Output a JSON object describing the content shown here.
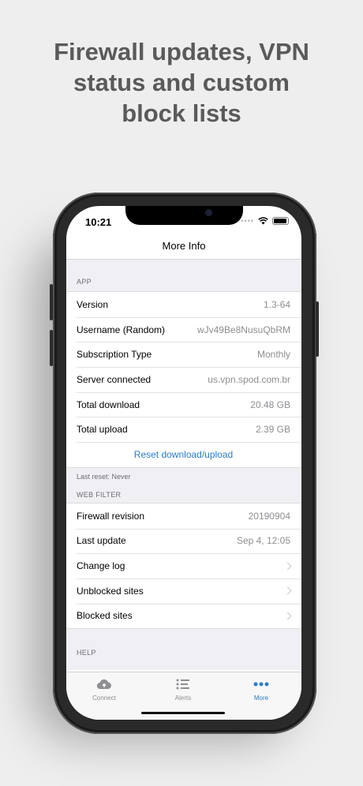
{
  "promo": {
    "line1": "Firewall updates, VPN",
    "line2": "status and custom",
    "line3": "block lists"
  },
  "status_bar": {
    "time": "10:21"
  },
  "nav": {
    "title": "More Info"
  },
  "sections": {
    "app": {
      "header": "APP",
      "rows": [
        {
          "label": "Version",
          "value": "1.3-64"
        },
        {
          "label": "Username (Random)",
          "value": "wJv49Be8NusuQbRM"
        },
        {
          "label": "Subscription Type",
          "value": "Monthly"
        },
        {
          "label": "Server connected",
          "value": "us.vpn.spod.com.br"
        },
        {
          "label": "Total download",
          "value": "20.48 GB"
        },
        {
          "label": "Total upload",
          "value": "2.39 GB"
        }
      ],
      "action": "Reset download/upload",
      "footer": "Last reset: Never"
    },
    "web_filter": {
      "header": "WEB FILTER",
      "rows": [
        {
          "label": "Firewall revision",
          "value": "20190904"
        },
        {
          "label": "Last update",
          "value": "Sep 4, 12:05"
        },
        {
          "label": "Change log"
        },
        {
          "label": "Unblocked sites"
        },
        {
          "label": "Blocked sites"
        }
      ]
    },
    "help": {
      "header": "HELP"
    }
  },
  "tabs": [
    {
      "label": "Connect",
      "icon": "cloud-upload-icon",
      "active": false
    },
    {
      "label": "Alerts",
      "icon": "list-icon",
      "active": false
    },
    {
      "label": "More",
      "icon": "more-dots-icon",
      "active": true
    }
  ],
  "colors": {
    "accent": "#2a7cc7",
    "headline": "#5a5a5a",
    "background": "#eeeeee"
  }
}
